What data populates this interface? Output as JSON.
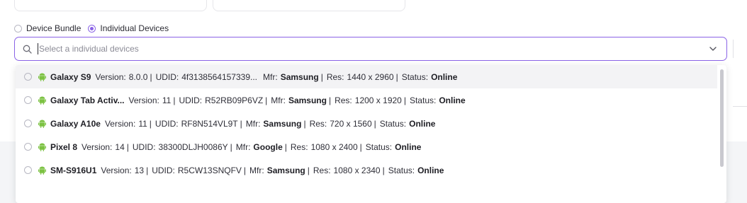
{
  "mode": {
    "options": [
      "Device Bundle",
      "Individual Devices"
    ],
    "selected": "Individual Devices"
  },
  "search": {
    "placeholder": "Select a individual devices",
    "value": ""
  },
  "labels": {
    "version": "Version:",
    "udid": "UDID:",
    "mfr": "Mfr:",
    "res": "Res:",
    "status": "Status:",
    "sep": "|"
  },
  "devices": [
    {
      "name": "Galaxy S9",
      "version": "8.0.0",
      "udid": "4f3138564157339...",
      "mfr": "Samsung",
      "res": "1440 x 2960",
      "status": "Online",
      "udid_sep": false
    },
    {
      "name": "Galaxy Tab Activ...",
      "version": "11",
      "udid": "R52RB09P6VZ",
      "mfr": "Samsung",
      "res": "1200 x 1920",
      "status": "Online",
      "udid_sep": true
    },
    {
      "name": "Galaxy A10e",
      "version": "11",
      "udid": "RF8N514VL9T",
      "mfr": "Samsung",
      "res": "720 x 1560",
      "status": "Online",
      "udid_sep": true
    },
    {
      "name": "Pixel 8",
      "version": "14",
      "udid": "38300DLJH0086Y",
      "mfr": "Google",
      "res": "1080 x 2400",
      "status": "Online",
      "udid_sep": true
    },
    {
      "name": "SM-S916U1",
      "version": "13",
      "udid": "R5CW13SNQFV",
      "mfr": "Samsung",
      "res": "1080 x 2340",
      "status": "Online",
      "udid_sep": true
    }
  ],
  "colors": {
    "accent": "#8a63e6",
    "android_green": "#7cc242",
    "hover_row": "#f3f3f5"
  },
  "icons": {
    "search": "search-icon",
    "dropdown": "chevron-down-icon",
    "platform": "android-icon"
  }
}
